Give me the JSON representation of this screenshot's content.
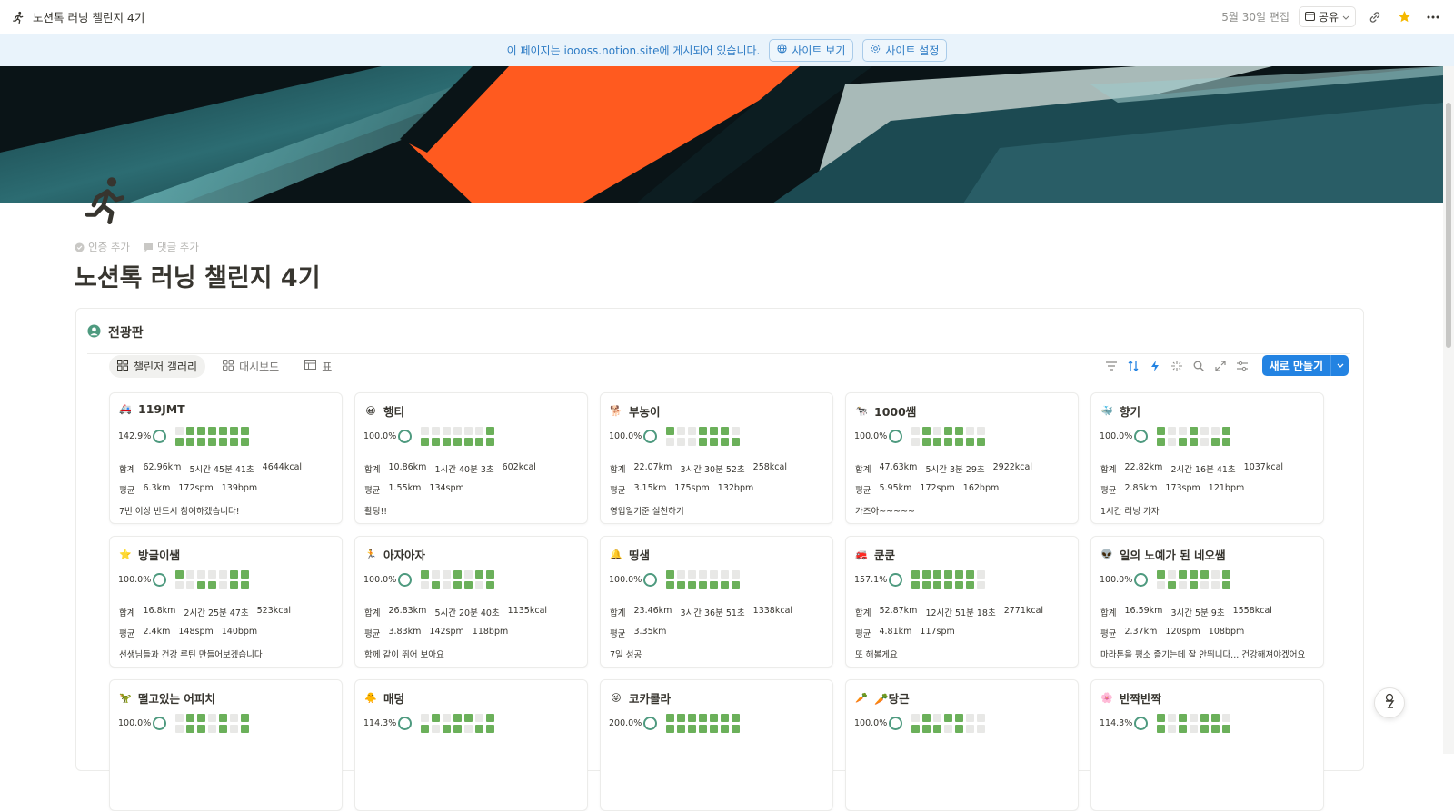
{
  "topbar": {
    "title": "노션톡 러닝 챌린지 4기",
    "edited": "5월 30일 편집",
    "share_label": "공유"
  },
  "banner": {
    "message": "이 페이지는 ioooss.notion.site에 게시되어 있습니다.",
    "view_site": "사이트 보기",
    "site_settings": "사이트 설정"
  },
  "meta": {
    "add_verification": "인증 추가",
    "add_comment": "댓글 추가"
  },
  "page": {
    "title": "노션톡 러닝 챌린지 4기"
  },
  "board": {
    "heading": "전광판",
    "tabs": [
      {
        "label": "챌린저 갤러리"
      },
      {
        "label": "대시보드"
      },
      {
        "label": "표"
      }
    ],
    "new_label": "새로 만들기"
  },
  "colors": {
    "accent": "#2383e2",
    "done": "#6bb05a",
    "empty": "#e8e8e6",
    "ring": "#4e9a7f"
  },
  "cards": [
    {
      "emoji": "🚑",
      "name": "119JMT",
      "pct": "142.9%",
      "total_label": "합계",
      "total": [
        "62.96km",
        "5시간 45분 41초",
        "4644kcal"
      ],
      "avg_label": "평균",
      "avg": [
        "6.3km",
        "172spm",
        "139bpm"
      ],
      "note": "7번 이상 반드시 참여하겠습니다!",
      "grid": [
        0,
        1,
        1,
        1,
        1,
        1,
        1,
        1,
        1,
        1,
        1,
        1,
        1,
        1
      ]
    },
    {
      "emoji": "😀",
      "name": "행티",
      "pct": "100.0%",
      "total_label": "합계",
      "total": [
        "10.86km",
        "1시간 40분 3초",
        "602kcal"
      ],
      "avg_label": "평균",
      "avg": [
        "1.55km",
        "134spm"
      ],
      "note": "활팅!!",
      "grid": [
        0,
        0,
        0,
        0,
        0,
        0,
        1,
        1,
        1,
        1,
        1,
        1,
        1,
        1
      ]
    },
    {
      "emoji": "🐕",
      "name": "부농이",
      "pct": "100.0%",
      "total_label": "합계",
      "total": [
        "22.07km",
        "3시간 30분 52초",
        "258kcal"
      ],
      "avg_label": "평균",
      "avg": [
        "3.15km",
        "175spm",
        "132bpm"
      ],
      "note": "영업일기준 실천하기",
      "grid": [
        1,
        0,
        0,
        1,
        1,
        1,
        0,
        0,
        0,
        0,
        1,
        1,
        1,
        1
      ]
    },
    {
      "emoji": "🐄",
      "name": "1000쌤",
      "pct": "100.0%",
      "total_label": "합계",
      "total": [
        "47.63km",
        "5시간 3분 29초",
        "2922kcal"
      ],
      "avg_label": "평균",
      "avg": [
        "5.95km",
        "172spm",
        "162bpm"
      ],
      "note": "가즈아~~~~~",
      "grid": [
        0,
        1,
        0,
        1,
        1,
        0,
        0,
        0,
        1,
        1,
        1,
        1,
        1,
        1
      ]
    },
    {
      "emoji": "🐳",
      "name": "향기",
      "pct": "100.0%",
      "total_label": "합계",
      "total": [
        "22.82km",
        "2시간 16분 41초",
        "1037kcal"
      ],
      "avg_label": "평균",
      "avg": [
        "2.85km",
        "173spm",
        "121bpm"
      ],
      "note": "1시간 러닝 가자",
      "grid": [
        1,
        0,
        0,
        1,
        0,
        0,
        1,
        1,
        0,
        1,
        1,
        0,
        1,
        1
      ]
    },
    {
      "emoji": "⭐",
      "name": "방글이쌤",
      "pct": "100.0%",
      "total_label": "합계",
      "total": [
        "16.8km",
        "2시간 25분 47초",
        "523kcal"
      ],
      "avg_label": "평균",
      "avg": [
        "2.4km",
        "148spm",
        "140bpm"
      ],
      "note": "선생님들과 건강 루틴 만들어보겠습니다!",
      "grid": [
        1,
        0,
        0,
        0,
        0,
        1,
        1,
        0,
        0,
        1,
        1,
        0,
        1,
        1
      ]
    },
    {
      "emoji": "🏃",
      "name": "아자아자",
      "pct": "100.0%",
      "total_label": "합계",
      "total": [
        "26.83km",
        "5시간 20분 40초",
        "1135kcal"
      ],
      "avg_label": "평균",
      "avg": [
        "3.83km",
        "142spm",
        "118bpm"
      ],
      "note": "함께 같이 뛰어 보아요",
      "grid": [
        1,
        0,
        0,
        1,
        0,
        1,
        1,
        0,
        1,
        0,
        1,
        1,
        0,
        1
      ]
    },
    {
      "emoji": "🔔",
      "name": "띵샘",
      "pct": "100.0%",
      "total_label": "합계",
      "total": [
        "23.46km",
        "3시간 36분 51초",
        "1338kcal"
      ],
      "avg_label": "평균",
      "avg": [
        "3.35km"
      ],
      "note": "7일 성공",
      "grid": [
        1,
        0,
        0,
        0,
        0,
        0,
        0,
        1,
        1,
        1,
        1,
        1,
        1,
        1
      ]
    },
    {
      "emoji": "🚒",
      "name": "쿤쿤",
      "pct": "157.1%",
      "total_label": "합계",
      "total": [
        "52.87km",
        "12시간 51분 18초",
        "2771kcal"
      ],
      "avg_label": "평균",
      "avg": [
        "4.81km",
        "117spm"
      ],
      "note": "또 해볼게요",
      "grid": [
        1,
        1,
        1,
        1,
        1,
        1,
        0,
        1,
        1,
        1,
        1,
        1,
        1,
        0
      ]
    },
    {
      "emoji": "👽",
      "name": "일의 노예가 된 네오쌤",
      "pct": "100.0%",
      "total_label": "합계",
      "total": [
        "16.59km",
        "3시간 5분 9초",
        "1558kcal"
      ],
      "avg_label": "평균",
      "avg": [
        "2.37km",
        "120spm",
        "108bpm"
      ],
      "note": "마라톤을 평소 즐기는데 잘 안뛰니다... 건강해져야겠어요",
      "grid": [
        1,
        0,
        1,
        1,
        1,
        0,
        1,
        0,
        1,
        0,
        1,
        0,
        0,
        1
      ]
    },
    {
      "emoji": "🦖",
      "name": "떨고있는 어피치",
      "pct": "100.0%",
      "total_label": "",
      "total": [],
      "avg_label": "",
      "avg": [],
      "note": "",
      "grid": [
        0,
        1,
        1,
        0,
        1,
        0,
        1,
        0,
        1,
        1,
        0,
        1,
        0,
        1
      ]
    },
    {
      "emoji": "🐥",
      "name": "매덩",
      "pct": "114.3%",
      "total_label": "",
      "total": [],
      "avg_label": "",
      "avg": [],
      "note": "",
      "grid": [
        0,
        1,
        0,
        1,
        1,
        0,
        1,
        1,
        0,
        1,
        1,
        0,
        1,
        1
      ]
    },
    {
      "emoji": "😜",
      "name": "코카콜라",
      "pct": "200.0%",
      "total_label": "",
      "total": [],
      "avg_label": "",
      "avg": [],
      "note": "",
      "grid": [
        1,
        1,
        1,
        1,
        1,
        1,
        1,
        1,
        1,
        1,
        1,
        1,
        1,
        1
      ]
    },
    {
      "emoji": "🥕",
      "name": "🥕당근",
      "pct": "100.0%",
      "total_label": "",
      "total": [],
      "avg_label": "",
      "avg": [],
      "note": "",
      "grid": [
        0,
        1,
        0,
        1,
        1,
        0,
        0,
        1,
        1,
        1,
        0,
        1,
        0,
        0
      ]
    },
    {
      "emoji": "🌸",
      "name": "반짝반짝",
      "pct": "114.3%",
      "total_label": "",
      "total": [],
      "avg_label": "",
      "avg": [],
      "note": "",
      "grid": [
        1,
        0,
        1,
        0,
        1,
        1,
        0,
        1,
        0,
        1,
        0,
        1,
        1,
        1
      ]
    }
  ]
}
